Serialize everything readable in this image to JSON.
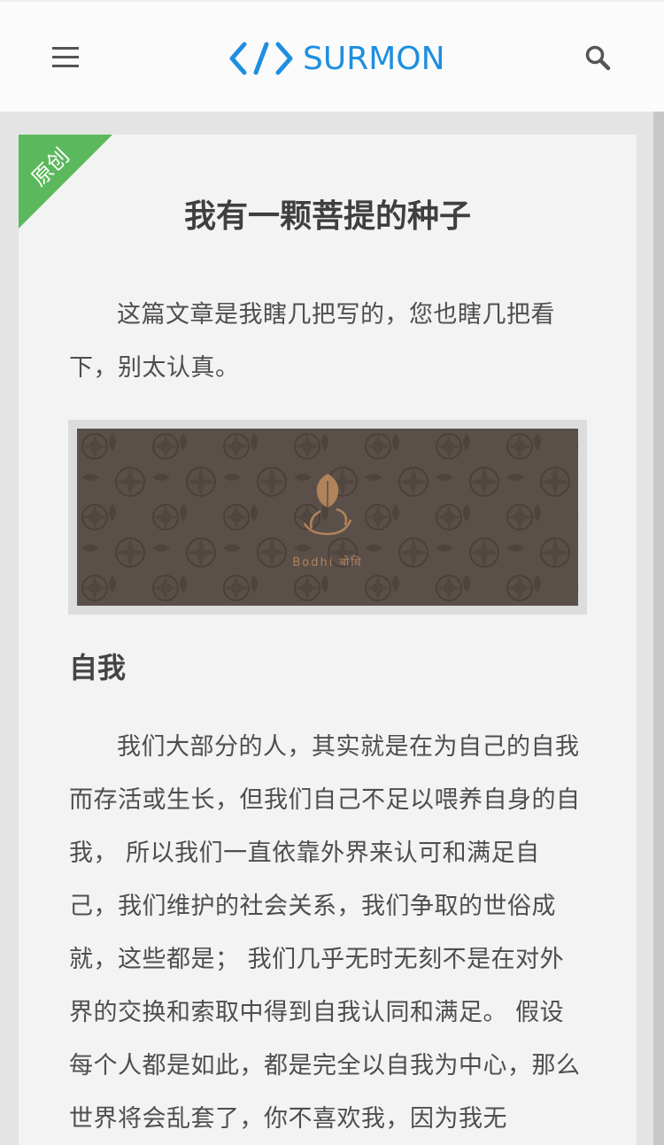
{
  "header": {
    "logo_text": "SURMON",
    "menu_icon": "hamburger-menu-icon",
    "search_icon": "search-icon",
    "brand_color": "#1e8fe0"
  },
  "article": {
    "badge": "原创",
    "badge_color": "#5cb85c",
    "title": "我有一颗菩提的种子",
    "intro": "这篇文章是我瞎几把写的，您也瞎几把看下，别太认真。",
    "banner_caption": "Bodhi बोधि",
    "section_heading": "自我",
    "paragraph": "我们大部分的人，其实就是在为自己的自我而存活或生长，但我们自己不足以喂养自身的自我， 所以我们一直依靠外界来认可和满足自己，我们维护的社会关系，我们争取的世俗成就，这些都是； 我们几乎无时无刻不是在对外界的交换和索取中得到自我认同和满足。 假设每个人都是如此，都是完全以自我为中心，那么世界将会乱套了，你不喜欢我，因为我无"
  }
}
